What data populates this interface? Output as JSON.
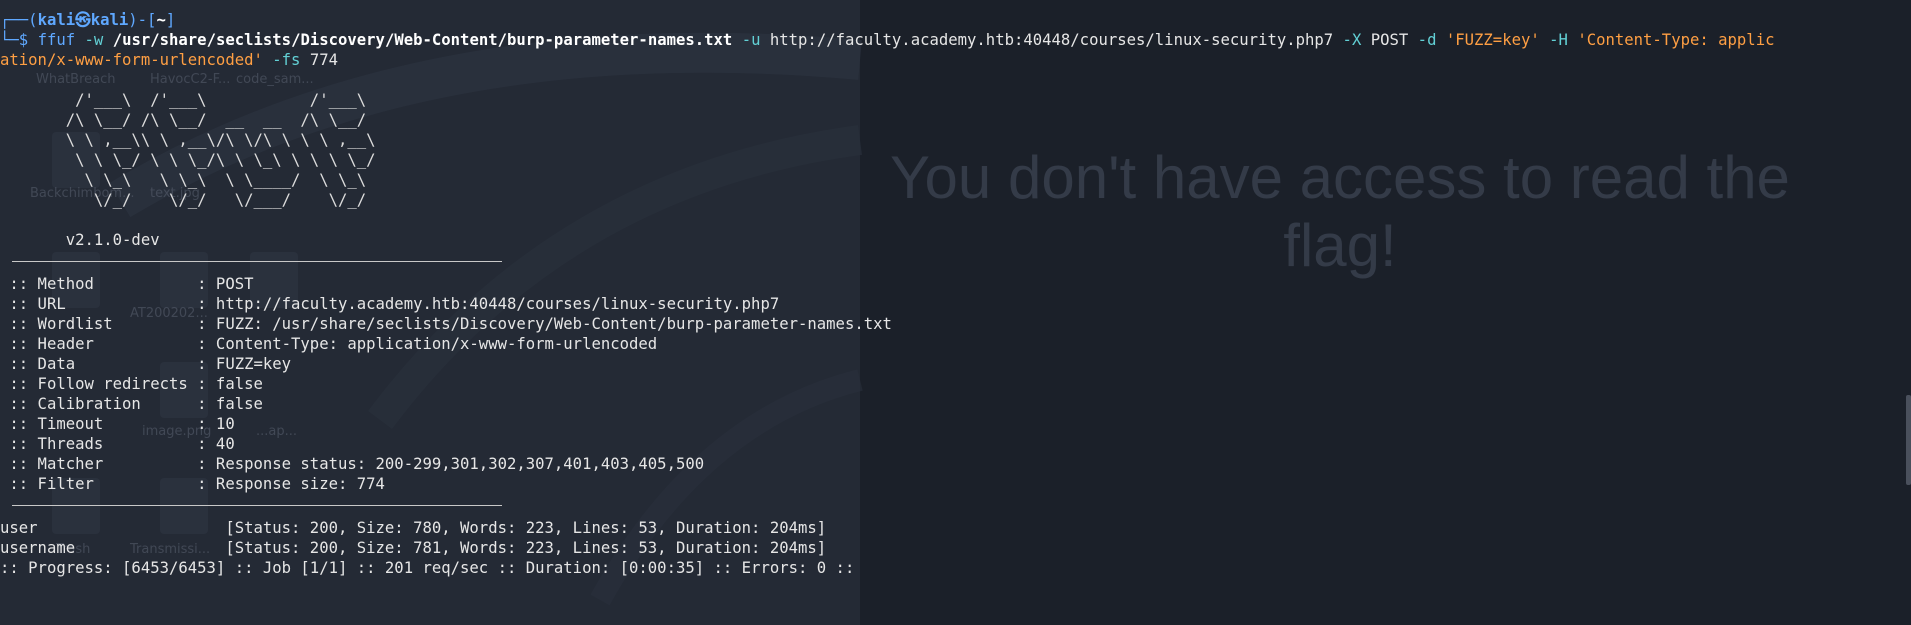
{
  "background": {
    "message": "You don't have access to read the flag!",
    "desktop_labels": [
      "WhatBreach",
      "HavocC2-F...",
      "code_sam...",
      "Backchimbom...",
      "text.jpg",
      "...",
      "AT200202...",
      "Trash",
      "Transmissi...",
      "image.png",
      "...ap..."
    ]
  },
  "prompt": {
    "open": "┌──(",
    "user": "kali㉿kali",
    "mid": ")-[",
    "dir": "~",
    "close": "]",
    "arrow": "└─$ "
  },
  "command": {
    "tool": "ffuf",
    "w_flag": " -w ",
    "wordlist": "/usr/share/seclists/Discovery/Web-Content/burp-parameter-names.txt",
    "u_flag": " -u ",
    "url": "http://faculty.academy.htb:40448/courses/linux-security.php7",
    "x_flag": " -X ",
    "method": "POST",
    "d_flag": " -d ",
    "data": "'FUZZ=key'",
    "h_flag": " -H ",
    "header_part1": "'Content-Type: applic",
    "header_part2": "ation/x-www-form-urlencoded'",
    "fs_flag": " -fs ",
    "fs_value": "774"
  },
  "banner": [
    "        /'___\\  /'___\\           /'___\\",
    "       /\\ \\__/ /\\ \\__/  __  __  /\\ \\__/",
    "       \\ \\ ,__\\\\ \\ ,__\\/\\ \\/\\ \\ \\ \\ ,__\\",
    "        \\ \\ \\_/ \\ \\ \\_/\\ \\ \\_\\ \\ \\ \\ \\_/",
    "         \\ \\_\\   \\ \\_\\  \\ \\____/  \\ \\_\\",
    "          \\/_/    \\/_/   \\/___/    \\/_/"
  ],
  "version": "       v2.1.0-dev",
  "config": [
    " :: Method           : POST",
    " :: URL              : http://faculty.academy.htb:40448/courses/linux-security.php7",
    " :: Wordlist         : FUZZ: /usr/share/seclists/Discovery/Web-Content/burp-parameter-names.txt",
    " :: Header           : Content-Type: application/x-www-form-urlencoded",
    " :: Data             : FUZZ=key",
    " :: Follow redirects : false",
    " :: Calibration      : false",
    " :: Timeout          : 10",
    " :: Threads          : 40",
    " :: Matcher          : Response status: 200-299,301,302,307,401,403,405,500",
    " :: Filter           : Response size: 774"
  ],
  "results": [
    "user                    [Status: 200, Size: 780, Words: 223, Lines: 53, Duration: 204ms]",
    "username                [Status: 200, Size: 781, Words: 223, Lines: 53, Duration: 204ms]"
  ],
  "progress": ":: Progress: [6453/6453] :: Job [1/1] :: 201 req/sec :: Duration: [0:00:35] :: Errors: 0 ::"
}
